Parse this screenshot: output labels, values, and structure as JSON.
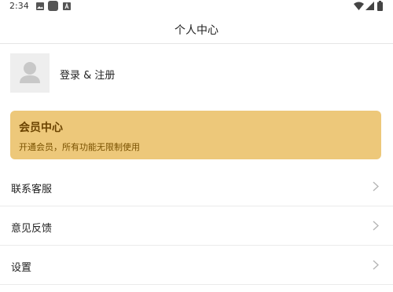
{
  "status_bar": {
    "time": "2:34",
    "icons": [
      "image-icon",
      "app-icon",
      "a-icon",
      "wifi-icon",
      "signal-icon",
      "battery-icon"
    ]
  },
  "header": {
    "title": "个人中心"
  },
  "profile": {
    "avatar_icon": "user-avatar-icon",
    "login_label": "登录 & 注册"
  },
  "vip_card": {
    "title": "会员中心",
    "description": "开通会员，所有功能无限制使用",
    "background_color": "#edc87a"
  },
  "menu": {
    "items": [
      {
        "label": "联系客服",
        "icon": "chevron-right-icon"
      },
      {
        "label": "意见反馈",
        "icon": "chevron-right-icon"
      },
      {
        "label": "设置",
        "icon": "chevron-right-icon"
      }
    ]
  }
}
